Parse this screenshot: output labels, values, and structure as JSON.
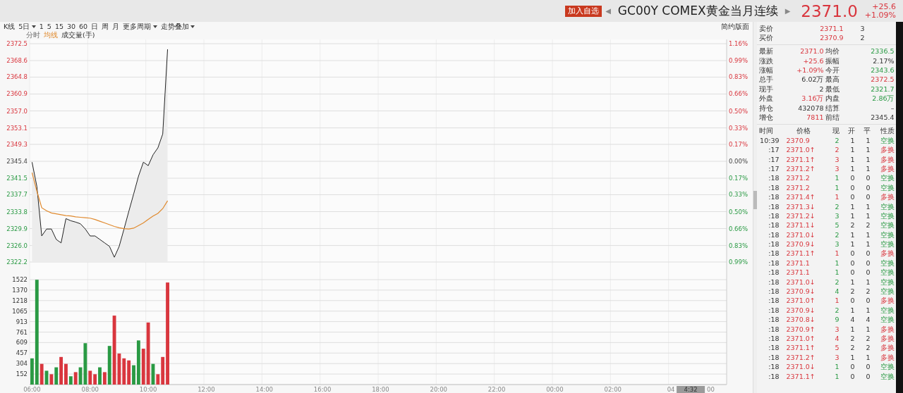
{
  "header": {
    "watch_button": "加入自选",
    "prev": "◀",
    "title": "GC00Y COMEX黄金当月连续",
    "next": "▶",
    "price": "2371.0",
    "change": "+25.6",
    "change_pct": "+1.09%"
  },
  "toolbar": {
    "periods": [
      {
        "label": "K线",
        "dropdown": false
      },
      {
        "label": "5日",
        "dropdown": true
      },
      {
        "label": "1",
        "dropdown": false
      },
      {
        "label": "5",
        "dropdown": false
      },
      {
        "label": "15",
        "dropdown": false
      },
      {
        "label": "30",
        "dropdown": false
      },
      {
        "label": "60",
        "dropdown": false
      },
      {
        "label": "日",
        "dropdown": false
      },
      {
        "label": "周",
        "dropdown": false
      },
      {
        "label": "月",
        "dropdown": false
      },
      {
        "label": "更多周期",
        "dropdown": true
      },
      {
        "label": "走势叠加",
        "dropdown": true
      }
    ],
    "layout_link": "简约版面"
  },
  "price_chart": {
    "pct_axis": [
      {
        "label": "1.16%",
        "kind": "up"
      },
      {
        "label": "0.99%",
        "kind": "up"
      },
      {
        "label": "0.83%",
        "kind": "up"
      },
      {
        "label": "0.66%",
        "kind": "up"
      },
      {
        "label": "0.50%",
        "kind": "up"
      },
      {
        "label": "0.33%",
        "kind": "up"
      },
      {
        "label": "0.17%",
        "kind": "up"
      },
      {
        "label": "0.00%",
        "kind": "flat"
      },
      {
        "label": "0.17%",
        "kind": "down"
      },
      {
        "label": "0.33%",
        "kind": "down"
      },
      {
        "label": "0.50%",
        "kind": "down"
      },
      {
        "label": "0.66%",
        "kind": "down"
      },
      {
        "label": "0.83%",
        "kind": "down"
      },
      {
        "label": "0.99%",
        "kind": "down"
      }
    ],
    "chart_data": {
      "type": "line",
      "grid": true,
      "categories": [
        null,
        null,
        null,
        null,
        null,
        null,
        null,
        null,
        null,
        null,
        null,
        null,
        null,
        null,
        null,
        null,
        null,
        null,
        null,
        null,
        null,
        null,
        null,
        null,
        null,
        null,
        null,
        null,
        null,
        null,
        null,
        null,
        null,
        null,
        null,
        null,
        null,
        null,
        null,
        null,
        null,
        null,
        null,
        null,
        null,
        null,
        null,
        null,
        null,
        null,
        null,
        null,
        null,
        null,
        null,
        null,
        null,
        null,
        null,
        null,
        null,
        null,
        null,
        null,
        null,
        null,
        null,
        null,
        null,
        null,
        null,
        null,
        null,
        null,
        null,
        null,
        null,
        null,
        null,
        null,
        null,
        null,
        null,
        null,
        null,
        null,
        null,
        null,
        null,
        null,
        null,
        null,
        null,
        null,
        null,
        null,
        null,
        null,
        null,
        null,
        null,
        null,
        null,
        null,
        null,
        null,
        null,
        null,
        null,
        null,
        null,
        null,
        null,
        null,
        null,
        null,
        null,
        null,
        null,
        null,
        null,
        null,
        null,
        null,
        null,
        null,
        null,
        null,
        null,
        null,
        null,
        null,
        null,
        null,
        null,
        null,
        null,
        null,
        null,
        null,
        null,
        null,
        null,
        null
      ],
      "series": [
        {
          "name": "分时",
          "color": "#222222",
          "values": [
            2345.2,
            2339.6,
            2328.2,
            2329.8,
            2329.8,
            2327.4,
            2326.6,
            2332.2,
            2331.7,
            2331.4,
            2331.0,
            2329.8,
            2328.2,
            2328.2,
            2327.4,
            2326.6,
            2325.8,
            2323.3,
            2325.8,
            2329.8,
            2333.9,
            2337.9,
            2342.0,
            2345.2,
            2344.4,
            2346.9,
            2348.5,
            2351.7,
            2371.2,
            null,
            null,
            null,
            null,
            null,
            null,
            null,
            null,
            null,
            null,
            null,
            null,
            null,
            null,
            null,
            null,
            null,
            null,
            null,
            null,
            null,
            null,
            null,
            null,
            null,
            null,
            null,
            null,
            null,
            null,
            null,
            null,
            null,
            null,
            null,
            null,
            null,
            null,
            null,
            null,
            null,
            null,
            null,
            null,
            null,
            null,
            null,
            null,
            null,
            null,
            null,
            null,
            null,
            null,
            null,
            null,
            null,
            null,
            null,
            null,
            null,
            null,
            null,
            null,
            null,
            null,
            null,
            null,
            null,
            null,
            null,
            null,
            null,
            null,
            null,
            null,
            null,
            null,
            null,
            null,
            null,
            null,
            null,
            null,
            null,
            null,
            null,
            null,
            null,
            null,
            null,
            null,
            null,
            null,
            null,
            null,
            null,
            null,
            null,
            null,
            null,
            null,
            null,
            null,
            null,
            null,
            null,
            null,
            null,
            null,
            null,
            null,
            null,
            null,
            null
          ]
        },
        {
          "name": "均线",
          "color": "#e08a2e",
          "values": [
            2342.8,
            2338.5,
            2334.7,
            2334.0,
            2333.5,
            2333.3,
            2333.1,
            2332.9,
            2332.8,
            2332.6,
            2332.5,
            2332.4,
            2332.3,
            2332.0,
            2331.6,
            2331.2,
            2330.8,
            2330.4,
            2330.1,
            2329.9,
            2329.8,
            2330.0,
            2330.6,
            2331.2,
            2332.0,
            2332.8,
            2333.4,
            2334.5,
            2336.3,
            null,
            null,
            null,
            null,
            null,
            null,
            null,
            null,
            null,
            null,
            null,
            null,
            null,
            null,
            null,
            null,
            null,
            null,
            null,
            null,
            null,
            null,
            null,
            null,
            null,
            null,
            null,
            null,
            null,
            null,
            null,
            null,
            null,
            null,
            null,
            null,
            null,
            null,
            null,
            null,
            null,
            null,
            null,
            null,
            null,
            null,
            null,
            null,
            null,
            null,
            null,
            null,
            null,
            null,
            null,
            null,
            null,
            null,
            null,
            null,
            null,
            null,
            null,
            null,
            null,
            null,
            null,
            null,
            null,
            null,
            null,
            null,
            null,
            null,
            null,
            null,
            null,
            null,
            null,
            null,
            null,
            null,
            null,
            null,
            null,
            null,
            null,
            null,
            null,
            null,
            null,
            null,
            null,
            null,
            null,
            null,
            null,
            null,
            null,
            null,
            null,
            null,
            null,
            null,
            null,
            null,
            null,
            null,
            null,
            null,
            null,
            null,
            null,
            null,
            null
          ]
        }
      ],
      "ylim": [
        2322.2,
        2372.5
      ],
      "yticks": [
        {
          "value": 2372.5,
          "label": "2372.5"
        },
        {
          "value": 2368.6,
          "label": "2368.6"
        },
        {
          "value": 2364.8,
          "label": "2364.8"
        },
        {
          "value": 2360.9,
          "label": "2360.9"
        },
        {
          "value": 2357.0,
          "label": "2357.0"
        },
        {
          "value": 2353.1,
          "label": "2353.1"
        },
        {
          "value": 2349.3,
          "label": "2349.3"
        },
        {
          "value": 2345.4,
          "label": "2345.4"
        },
        {
          "value": 2341.5,
          "label": "2341.5"
        },
        {
          "value": 2337.7,
          "label": "2337.7"
        },
        {
          "value": 2333.8,
          "label": "2333.8"
        },
        {
          "value": 2329.9,
          "label": "2329.9"
        },
        {
          "value": 2326.0,
          "label": "2326.0"
        },
        {
          "value": 2322.2,
          "label": "2322.2"
        }
      ]
    }
  },
  "volume_chart": {
    "cursor_time": "4:32",
    "axis_tail": "00",
    "chart_data": {
      "type": "bar",
      "grid": true,
      "categories": [
        "06:00",
        null,
        null,
        null,
        null,
        null,
        null,
        null,
        null,
        null,
        null,
        null,
        "08:00",
        null,
        null,
        null,
        null,
        null,
        null,
        null,
        null,
        null,
        null,
        null,
        "10:00",
        null,
        null,
        null,
        null,
        null,
        null,
        null,
        null,
        null,
        null,
        null,
        "12:00",
        null,
        null,
        null,
        null,
        null,
        null,
        null,
        null,
        null,
        null,
        null,
        "14:00",
        null,
        null,
        null,
        null,
        null,
        null,
        null,
        null,
        null,
        null,
        null,
        "16:00",
        null,
        null,
        null,
        null,
        null,
        null,
        null,
        null,
        null,
        null,
        null,
        "18:00",
        null,
        null,
        null,
        null,
        null,
        null,
        null,
        null,
        null,
        null,
        null,
        "20:00",
        null,
        null,
        null,
        null,
        null,
        null,
        null,
        null,
        null,
        null,
        null,
        "22:00",
        null,
        null,
        null,
        null,
        null,
        null,
        null,
        null,
        null,
        null,
        null,
        "00:00",
        null,
        null,
        null,
        null,
        null,
        null,
        null,
        null,
        null,
        null,
        null,
        "02:00",
        null,
        null,
        null,
        null,
        null,
        null,
        null,
        null,
        null,
        null,
        null,
        "04",
        null,
        null,
        null,
        null,
        null,
        null,
        null,
        null,
        null,
        null,
        null
      ],
      "series": [
        {
          "name": "成交量(手)",
          "color": "#d9363e",
          "values": [
            null,
            null,
            300,
            null,
            150,
            null,
            400,
            300,
            null,
            180,
            null,
            null,
            200,
            150,
            null,
            180,
            null,
            1000,
            450,
            380,
            350,
            null,
            null,
            520,
            900,
            null,
            150,
            400,
            1480,
            null,
            null,
            null,
            null,
            null,
            null,
            null,
            null,
            null,
            null,
            null,
            null,
            null,
            null,
            null,
            null,
            null,
            null,
            null,
            null,
            null,
            null,
            null,
            null,
            null,
            null,
            null,
            null,
            null,
            null,
            null,
            null,
            null,
            null,
            null,
            null,
            null,
            null,
            null,
            null,
            null,
            null,
            null,
            null,
            null,
            null,
            null,
            null,
            null,
            null,
            null,
            null,
            null,
            null,
            null,
            null,
            null,
            null,
            null,
            null,
            null,
            null,
            null,
            null,
            null,
            null,
            null,
            null,
            null,
            null,
            null,
            null,
            null,
            null,
            null,
            null,
            null,
            null,
            null,
            null,
            null,
            null,
            null,
            null,
            null,
            null,
            null,
            null,
            null,
            null,
            null,
            null,
            null,
            null,
            null,
            null,
            null,
            null,
            null,
            null,
            null,
            null,
            null,
            null,
            null,
            null,
            null,
            null,
            null,
            null,
            null,
            null,
            null,
            null,
            null
          ]
        },
        {
          "color": "#2a9a44",
          "values": [
            380,
            1520,
            null,
            200,
            null,
            250,
            null,
            null,
            120,
            null,
            250,
            600,
            null,
            null,
            250,
            null,
            560,
            null,
            null,
            null,
            null,
            280,
            640,
            null,
            null,
            300,
            null,
            null,
            null,
            null,
            null,
            null,
            null,
            null,
            null,
            null,
            null,
            null,
            null,
            null,
            null,
            null,
            null,
            null,
            null,
            null,
            null,
            null,
            null,
            null,
            null,
            null,
            null,
            null,
            null,
            null,
            null,
            null,
            null,
            null,
            null,
            null,
            null,
            null,
            null,
            null,
            null,
            null,
            null,
            null,
            null,
            null,
            null,
            null,
            null,
            null,
            null,
            null,
            null,
            null,
            null,
            null,
            null,
            null,
            null,
            null,
            null,
            null,
            null,
            null,
            null,
            null,
            null,
            null,
            null,
            null,
            null,
            null,
            null,
            null,
            null,
            null,
            null,
            null,
            null,
            null,
            null,
            null,
            null,
            null,
            null,
            null,
            null,
            null,
            null,
            null,
            null,
            null,
            null,
            null,
            null,
            null,
            null,
            null,
            null,
            null,
            null,
            null,
            null,
            null,
            null,
            null,
            null,
            null,
            null,
            null,
            null,
            null,
            null,
            null,
            null,
            null,
            null,
            null
          ]
        }
      ],
      "ylim": [
        0,
        1522
      ],
      "yticks": [
        1522,
        1370,
        1218,
        1065,
        913,
        761,
        609,
        457,
        304,
        152
      ]
    }
  },
  "order_book": [
    {
      "label": "卖价",
      "price": "2371.1",
      "qty": "3"
    },
    {
      "label": "买价",
      "price": "2370.9",
      "qty": "2"
    }
  ],
  "stats": [
    {
      "label": "最新",
      "value": "2371.0",
      "kind": "up"
    },
    {
      "label": "均价",
      "value": "2336.5",
      "kind": "down"
    },
    {
      "label": "涨跌",
      "value": "+25.6",
      "kind": "up"
    },
    {
      "label": "振幅",
      "value": "2.17%",
      "kind": "flat"
    },
    {
      "label": "涨幅",
      "value": "+1.09%",
      "kind": "up"
    },
    {
      "label": "今开",
      "value": "2343.6",
      "kind": "down"
    },
    {
      "label": "总手",
      "value": "6.02万",
      "kind": "flat"
    },
    {
      "label": "最高",
      "value": "2372.5",
      "kind": "up"
    },
    {
      "label": "现手",
      "value": "2",
      "kind": "flat"
    },
    {
      "label": "最低",
      "value": "2321.7",
      "kind": "down"
    },
    {
      "label": "外盘",
      "value": "3.16万",
      "kind": "up"
    },
    {
      "label": "内盘",
      "value": "2.86万",
      "kind": "down"
    },
    {
      "label": "持仓",
      "value": "432078",
      "kind": "flat"
    },
    {
      "label": "结算",
      "value": "–",
      "kind": "flat"
    },
    {
      "label": "增仓",
      "value": "7811",
      "kind": "up"
    },
    {
      "label": "前结",
      "value": "2345.4",
      "kind": "flat"
    }
  ],
  "trades": {
    "columns": [
      "时间",
      "价格",
      "现",
      "开",
      "平",
      "性质"
    ],
    "rows": [
      {
        "time": "10:39",
        "price": "2370.9",
        "vol": "2",
        "open": "1",
        "close": "1",
        "type": "空换",
        "kind": "sell"
      },
      {
        "time": ":17",
        "price": "2371.0↑",
        "vol": "2",
        "open": "1",
        "close": "1",
        "type": "多换",
        "kind": "buy"
      },
      {
        "time": ":17",
        "price": "2371.1↑",
        "vol": "3",
        "open": "1",
        "close": "1",
        "type": "多换",
        "kind": "buy"
      },
      {
        "time": ":17",
        "price": "2371.2↑",
        "vol": "3",
        "open": "1",
        "close": "1",
        "type": "多换",
        "kind": "buy"
      },
      {
        "time": ":18",
        "price": "2371.2",
        "vol": "1",
        "open": "0",
        "close": "0",
        "type": "空换",
        "kind": "sell"
      },
      {
        "time": ":18",
        "price": "2371.2",
        "vol": "1",
        "open": "0",
        "close": "0",
        "type": "空换",
        "kind": "sell"
      },
      {
        "time": ":18",
        "price": "2371.4↑",
        "vol": "1",
        "open": "0",
        "close": "0",
        "type": "多换",
        "kind": "buy"
      },
      {
        "time": ":18",
        "price": "2371.3↓",
        "vol": "2",
        "open": "1",
        "close": "1",
        "type": "空换",
        "kind": "sell"
      },
      {
        "time": ":18",
        "price": "2371.2↓",
        "vol": "3",
        "open": "1",
        "close": "1",
        "type": "空换",
        "kind": "sell"
      },
      {
        "time": ":18",
        "price": "2371.1↓",
        "vol": "5",
        "open": "2",
        "close": "2",
        "type": "空换",
        "kind": "sell"
      },
      {
        "time": ":18",
        "price": "2371.0↓",
        "vol": "2",
        "open": "1",
        "close": "1",
        "type": "空换",
        "kind": "sell"
      },
      {
        "time": ":18",
        "price": "2370.9↓",
        "vol": "3",
        "open": "1",
        "close": "1",
        "type": "空换",
        "kind": "sell"
      },
      {
        "time": ":18",
        "price": "2371.1↑",
        "vol": "1",
        "open": "0",
        "close": "0",
        "type": "多换",
        "kind": "buy"
      },
      {
        "time": ":18",
        "price": "2371.1",
        "vol": "1",
        "open": "0",
        "close": "0",
        "type": "空换",
        "kind": "sell"
      },
      {
        "time": ":18",
        "price": "2371.1",
        "vol": "1",
        "open": "0",
        "close": "0",
        "type": "空换",
        "kind": "sell"
      },
      {
        "time": ":18",
        "price": "2371.0↓",
        "vol": "2",
        "open": "1",
        "close": "1",
        "type": "空换",
        "kind": "sell"
      },
      {
        "time": ":18",
        "price": "2370.9↓",
        "vol": "4",
        "open": "2",
        "close": "2",
        "type": "空换",
        "kind": "sell"
      },
      {
        "time": ":18",
        "price": "2371.0↑",
        "vol": "1",
        "open": "0",
        "close": "0",
        "type": "多换",
        "kind": "buy"
      },
      {
        "time": ":18",
        "price": "2370.9↓",
        "vol": "2",
        "open": "1",
        "close": "1",
        "type": "空换",
        "kind": "sell"
      },
      {
        "time": ":18",
        "price": "2370.8↓",
        "vol": "9",
        "open": "4",
        "close": "4",
        "type": "空换",
        "kind": "sell"
      },
      {
        "time": ":18",
        "price": "2370.9↑",
        "vol": "3",
        "open": "1",
        "close": "1",
        "type": "多换",
        "kind": "buy"
      },
      {
        "time": ":18",
        "price": "2371.0↑",
        "vol": "4",
        "open": "2",
        "close": "2",
        "type": "多换",
        "kind": "buy"
      },
      {
        "time": ":18",
        "price": "2371.1↑",
        "vol": "5",
        "open": "2",
        "close": "2",
        "type": "多换",
        "kind": "buy"
      },
      {
        "time": ":18",
        "price": "2371.2↑",
        "vol": "3",
        "open": "1",
        "close": "1",
        "type": "多换",
        "kind": "buy"
      },
      {
        "time": ":18",
        "price": "2371.0↓",
        "vol": "1",
        "open": "0",
        "close": "0",
        "type": "空换",
        "kind": "sell"
      },
      {
        "time": ":18",
        "price": "2371.1↑",
        "vol": "1",
        "open": "0",
        "close": "0",
        "type": "空换",
        "kind": "sell"
      }
    ]
  }
}
